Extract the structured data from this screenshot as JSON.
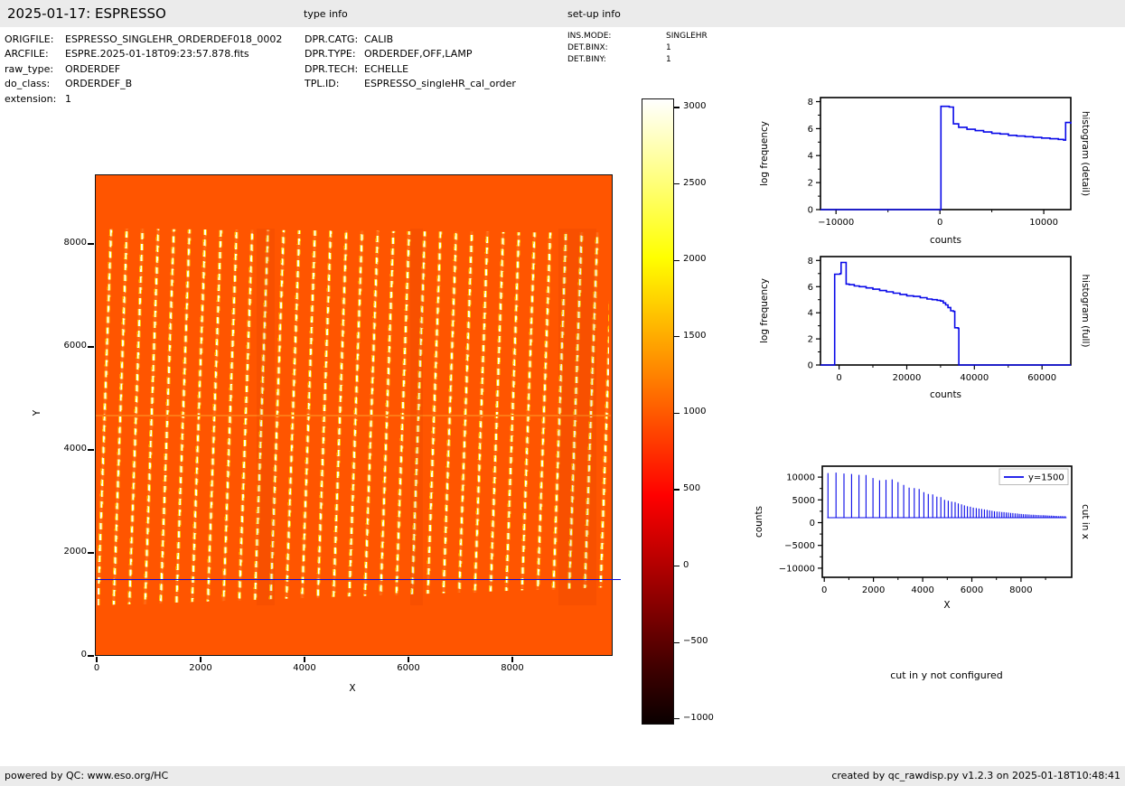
{
  "header": {
    "title": "2025-01-17: ESPRESSO",
    "type_info_label": "type info",
    "setup_info_label": "set-up info"
  },
  "metadata": {
    "file": [
      {
        "label": "ORIGFILE:",
        "value": "ESPRESSO_SINGLEHR_ORDERDEF018_0002"
      },
      {
        "label": "ARCFILE:",
        "value": "ESPRE.2025-01-18T09:23:57.878.fits"
      },
      {
        "label": "raw_type:",
        "value": "ORDERDEF"
      },
      {
        "label": "do_class:",
        "value": "ORDERDEF_B"
      },
      {
        "label": "extension:",
        "value": "1"
      }
    ],
    "type": [
      {
        "label": "DPR.CATG:",
        "value": "CALIB"
      },
      {
        "label": "DPR.TYPE:",
        "value": "ORDERDEF,OFF,LAMP"
      },
      {
        "label": "DPR.TECH:",
        "value": "ECHELLE"
      },
      {
        "label": "TPL.ID:",
        "value": "ESPRESSO_singleHR_cal_order"
      }
    ],
    "setup": [
      {
        "label": "INS.MODE:",
        "value": "SINGLEHR"
      },
      {
        "label": "DET.BINX:",
        "value": "1"
      },
      {
        "label": "DET.BINY:",
        "value": "1"
      }
    ]
  },
  "main_plot": {
    "xlabel": "X",
    "ylabel": "Y",
    "xticks": [
      "0",
      "2000",
      "4000",
      "6000",
      "8000"
    ],
    "yticks": [
      "8000",
      "6000",
      "4000",
      "2000",
      "0"
    ],
    "cut_line_y": 1500,
    "cut_line_color": "#0000dd",
    "background_color": "#ff5500"
  },
  "colorbar": {
    "colormap": "hot",
    "vmin": -1000,
    "vmax": 3060,
    "ticks": [
      "3000",
      "2500",
      "2000",
      "1500",
      "1000",
      "500",
      "0",
      "−500",
      "−1000"
    ]
  },
  "cut_y_note": "cut in y not configured",
  "footer": {
    "left": "powered by QC: www.eso.org/HC",
    "right": "created by qc_rawdisp.py v1.2.3 on 2025-01-18T10:48:41"
  },
  "chart_data": [
    {
      "id": "raw_image",
      "type": "heatmap",
      "xlabel": "X",
      "ylabel": "Y",
      "xlim": [
        0,
        9900
      ],
      "ylim": [
        0,
        9300
      ],
      "xticks": [
        0,
        2000,
        4000,
        6000,
        8000
      ],
      "yticks": [
        0,
        2000,
        4000,
        6000,
        8000
      ],
      "colormap": "hot",
      "clim": [
        -1000,
        3060
      ],
      "background_level": 1000,
      "orders": {
        "approx_count": 33,
        "y_extent": [
          1000,
          8300
        ]
      },
      "overlay_cut_line_y": 1500
    },
    {
      "id": "histogram_detail",
      "type": "line",
      "step": true,
      "right_label": "histogram (detail)",
      "xlabel": "counts",
      "ylabel": "log frequency",
      "xlim": [
        -11500,
        12600
      ],
      "ylim": [
        0,
        8.3
      ],
      "xticks": [
        -10000,
        0,
        10000
      ],
      "xminor": [
        -5000,
        5000
      ],
      "yticks": [
        0,
        2,
        4,
        6,
        8
      ],
      "yminor": [
        1,
        3,
        5,
        7
      ],
      "line_color": "#0808e8",
      "points": [
        [
          -11500,
          0
        ],
        [
          0,
          0
        ],
        [
          100,
          7.65
        ],
        [
          900,
          7.6
        ],
        [
          1300,
          6.35
        ],
        [
          1800,
          6.1
        ],
        [
          2600,
          5.95
        ],
        [
          3400,
          5.85
        ],
        [
          4200,
          5.75
        ],
        [
          5000,
          5.65
        ],
        [
          5800,
          5.6
        ],
        [
          6600,
          5.5
        ],
        [
          7400,
          5.45
        ],
        [
          8200,
          5.4
        ],
        [
          9000,
          5.35
        ],
        [
          9800,
          5.3
        ],
        [
          10600,
          5.25
        ],
        [
          11400,
          5.2
        ],
        [
          11900,
          5.15
        ],
        [
          12100,
          6.45
        ],
        [
          12600,
          6.35
        ]
      ]
    },
    {
      "id": "histogram_full",
      "type": "line",
      "step": true,
      "right_label": "histogram (full)",
      "xlabel": "counts",
      "ylabel": "log frequency",
      "xlim": [
        -5500,
        68500
      ],
      "ylim": [
        0,
        8.3
      ],
      "xticks": [
        0,
        20000,
        40000,
        60000
      ],
      "xminor": [
        10000,
        30000,
        50000
      ],
      "yticks": [
        0,
        2,
        4,
        6,
        8
      ],
      "yminor": [
        1,
        3,
        5,
        7
      ],
      "line_color": "#0808e8",
      "points": [
        [
          -5500,
          0
        ],
        [
          -1500,
          0
        ],
        [
          -1300,
          6.95
        ],
        [
          300,
          7.0
        ],
        [
          600,
          7.85
        ],
        [
          1700,
          7.85
        ],
        [
          2100,
          6.2
        ],
        [
          3000,
          6.15
        ],
        [
          4500,
          6.05
        ],
        [
          6000,
          6.0
        ],
        [
          8000,
          5.9
        ],
        [
          10000,
          5.8
        ],
        [
          12000,
          5.7
        ],
        [
          14000,
          5.6
        ],
        [
          16000,
          5.5
        ],
        [
          18000,
          5.4
        ],
        [
          20000,
          5.3
        ],
        [
          22000,
          5.25
        ],
        [
          24000,
          5.15
        ],
        [
          26000,
          5.05
        ],
        [
          27500,
          5.0
        ],
        [
          29000,
          4.95
        ],
        [
          30000,
          4.9
        ],
        [
          30800,
          4.75
        ],
        [
          31500,
          4.6
        ],
        [
          32200,
          4.4
        ],
        [
          33000,
          4.15
        ],
        [
          33800,
          4.1
        ],
        [
          34200,
          2.85
        ],
        [
          35200,
          2.8
        ],
        [
          35400,
          0
        ],
        [
          68500,
          0
        ]
      ]
    },
    {
      "id": "cut_in_x",
      "type": "line",
      "right_label": "cut in x",
      "legend": "y=1500",
      "legend_position": "upper right",
      "xlabel": "X",
      "ylabel": "counts",
      "xlim": [
        -80,
        10060
      ],
      "ylim": [
        -12000,
        12400
      ],
      "xticks": [
        0,
        2000,
        4000,
        6000,
        8000
      ],
      "xminor": [
        1000,
        3000,
        5000,
        7000,
        9000
      ],
      "yticks": [
        -10000,
        -5000,
        0,
        5000,
        10000
      ],
      "yminor": [
        -7500,
        -2500,
        2500,
        7500
      ],
      "line_color": "#0808e8",
      "baseline": 1100,
      "x_start": 120,
      "x_end": 9850,
      "spikes": [
        [
          150,
          10900
        ],
        [
          480,
          11000
        ],
        [
          800,
          10800
        ],
        [
          1110,
          10700
        ],
        [
          1410,
          10500
        ],
        [
          1700,
          10450
        ],
        [
          1980,
          9800
        ],
        [
          2250,
          9300
        ],
        [
          2510,
          9400
        ],
        [
          2760,
          9500
        ],
        [
          3000,
          8900
        ],
        [
          3230,
          8300
        ],
        [
          3450,
          7700
        ],
        [
          3660,
          7600
        ],
        [
          3860,
          7400
        ],
        [
          4050,
          6700
        ],
        [
          4230,
          6300
        ],
        [
          4410,
          6200
        ],
        [
          4580,
          5700
        ],
        [
          4740,
          5600
        ],
        [
          4890,
          5000
        ],
        [
          5040,
          4800
        ],
        [
          5180,
          4600
        ],
        [
          5320,
          4500
        ],
        [
          5450,
          4200
        ],
        [
          5580,
          4000
        ],
        [
          5700,
          3800
        ],
        [
          5820,
          3600
        ],
        [
          5940,
          3500
        ],
        [
          6060,
          3300
        ],
        [
          6180,
          3200
        ],
        [
          6290,
          3100
        ],
        [
          6400,
          3000
        ],
        [
          6510,
          2900
        ],
        [
          6620,
          2800
        ],
        [
          6720,
          2700
        ],
        [
          6820,
          2600
        ],
        [
          6920,
          2500
        ],
        [
          7020,
          2450
        ],
        [
          7120,
          2400
        ],
        [
          7220,
          2350
        ],
        [
          7310,
          2300
        ],
        [
          7400,
          2250
        ],
        [
          7490,
          2200
        ],
        [
          7580,
          2150
        ],
        [
          7670,
          2100
        ],
        [
          7760,
          2050
        ],
        [
          7850,
          2000
        ],
        [
          7930,
          1950
        ],
        [
          8010,
          1900
        ],
        [
          8090,
          1870
        ],
        [
          8170,
          1840
        ],
        [
          8250,
          1810
        ],
        [
          8330,
          1780
        ],
        [
          8410,
          1750
        ],
        [
          8490,
          1720
        ],
        [
          8570,
          1700
        ],
        [
          8650,
          1680
        ],
        [
          8730,
          1660
        ],
        [
          8810,
          1640
        ],
        [
          8890,
          1620
        ],
        [
          8960,
          1600
        ],
        [
          9030,
          1580
        ],
        [
          9100,
          1560
        ],
        [
          9170,
          1540
        ],
        [
          9240,
          1520
        ],
        [
          9310,
          1500
        ],
        [
          9380,
          1480
        ],
        [
          9450,
          1460
        ],
        [
          9520,
          1450
        ],
        [
          9590,
          1440
        ],
        [
          9660,
          1430
        ],
        [
          9730,
          1420
        ],
        [
          9800,
          1410
        ]
      ]
    }
  ]
}
